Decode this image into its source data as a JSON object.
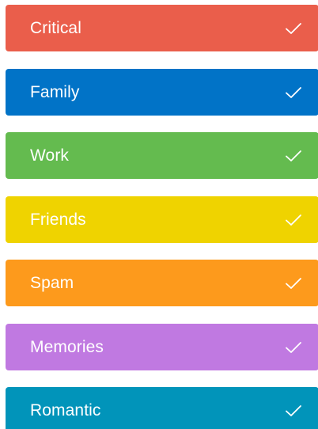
{
  "labels": [
    {
      "name": "Critical",
      "color": "#ea5e4b",
      "selected": true,
      "icon": "check-icon"
    },
    {
      "name": "Family",
      "color": "#0173c7",
      "selected": true,
      "icon": "check-icon"
    },
    {
      "name": "Work",
      "color": "#64bb4f",
      "selected": true,
      "icon": "check-icon"
    },
    {
      "name": "Friends",
      "color": "#efd300",
      "selected": true,
      "icon": "check-icon"
    },
    {
      "name": "Spam",
      "color": "#fd9a1c",
      "selected": true,
      "icon": "check-icon"
    },
    {
      "name": "Memories",
      "color": "#c079e1",
      "selected": true,
      "icon": "check-icon"
    },
    {
      "name": "Romantic",
      "color": "#0194ba",
      "selected": true,
      "icon": "check-icon"
    }
  ]
}
